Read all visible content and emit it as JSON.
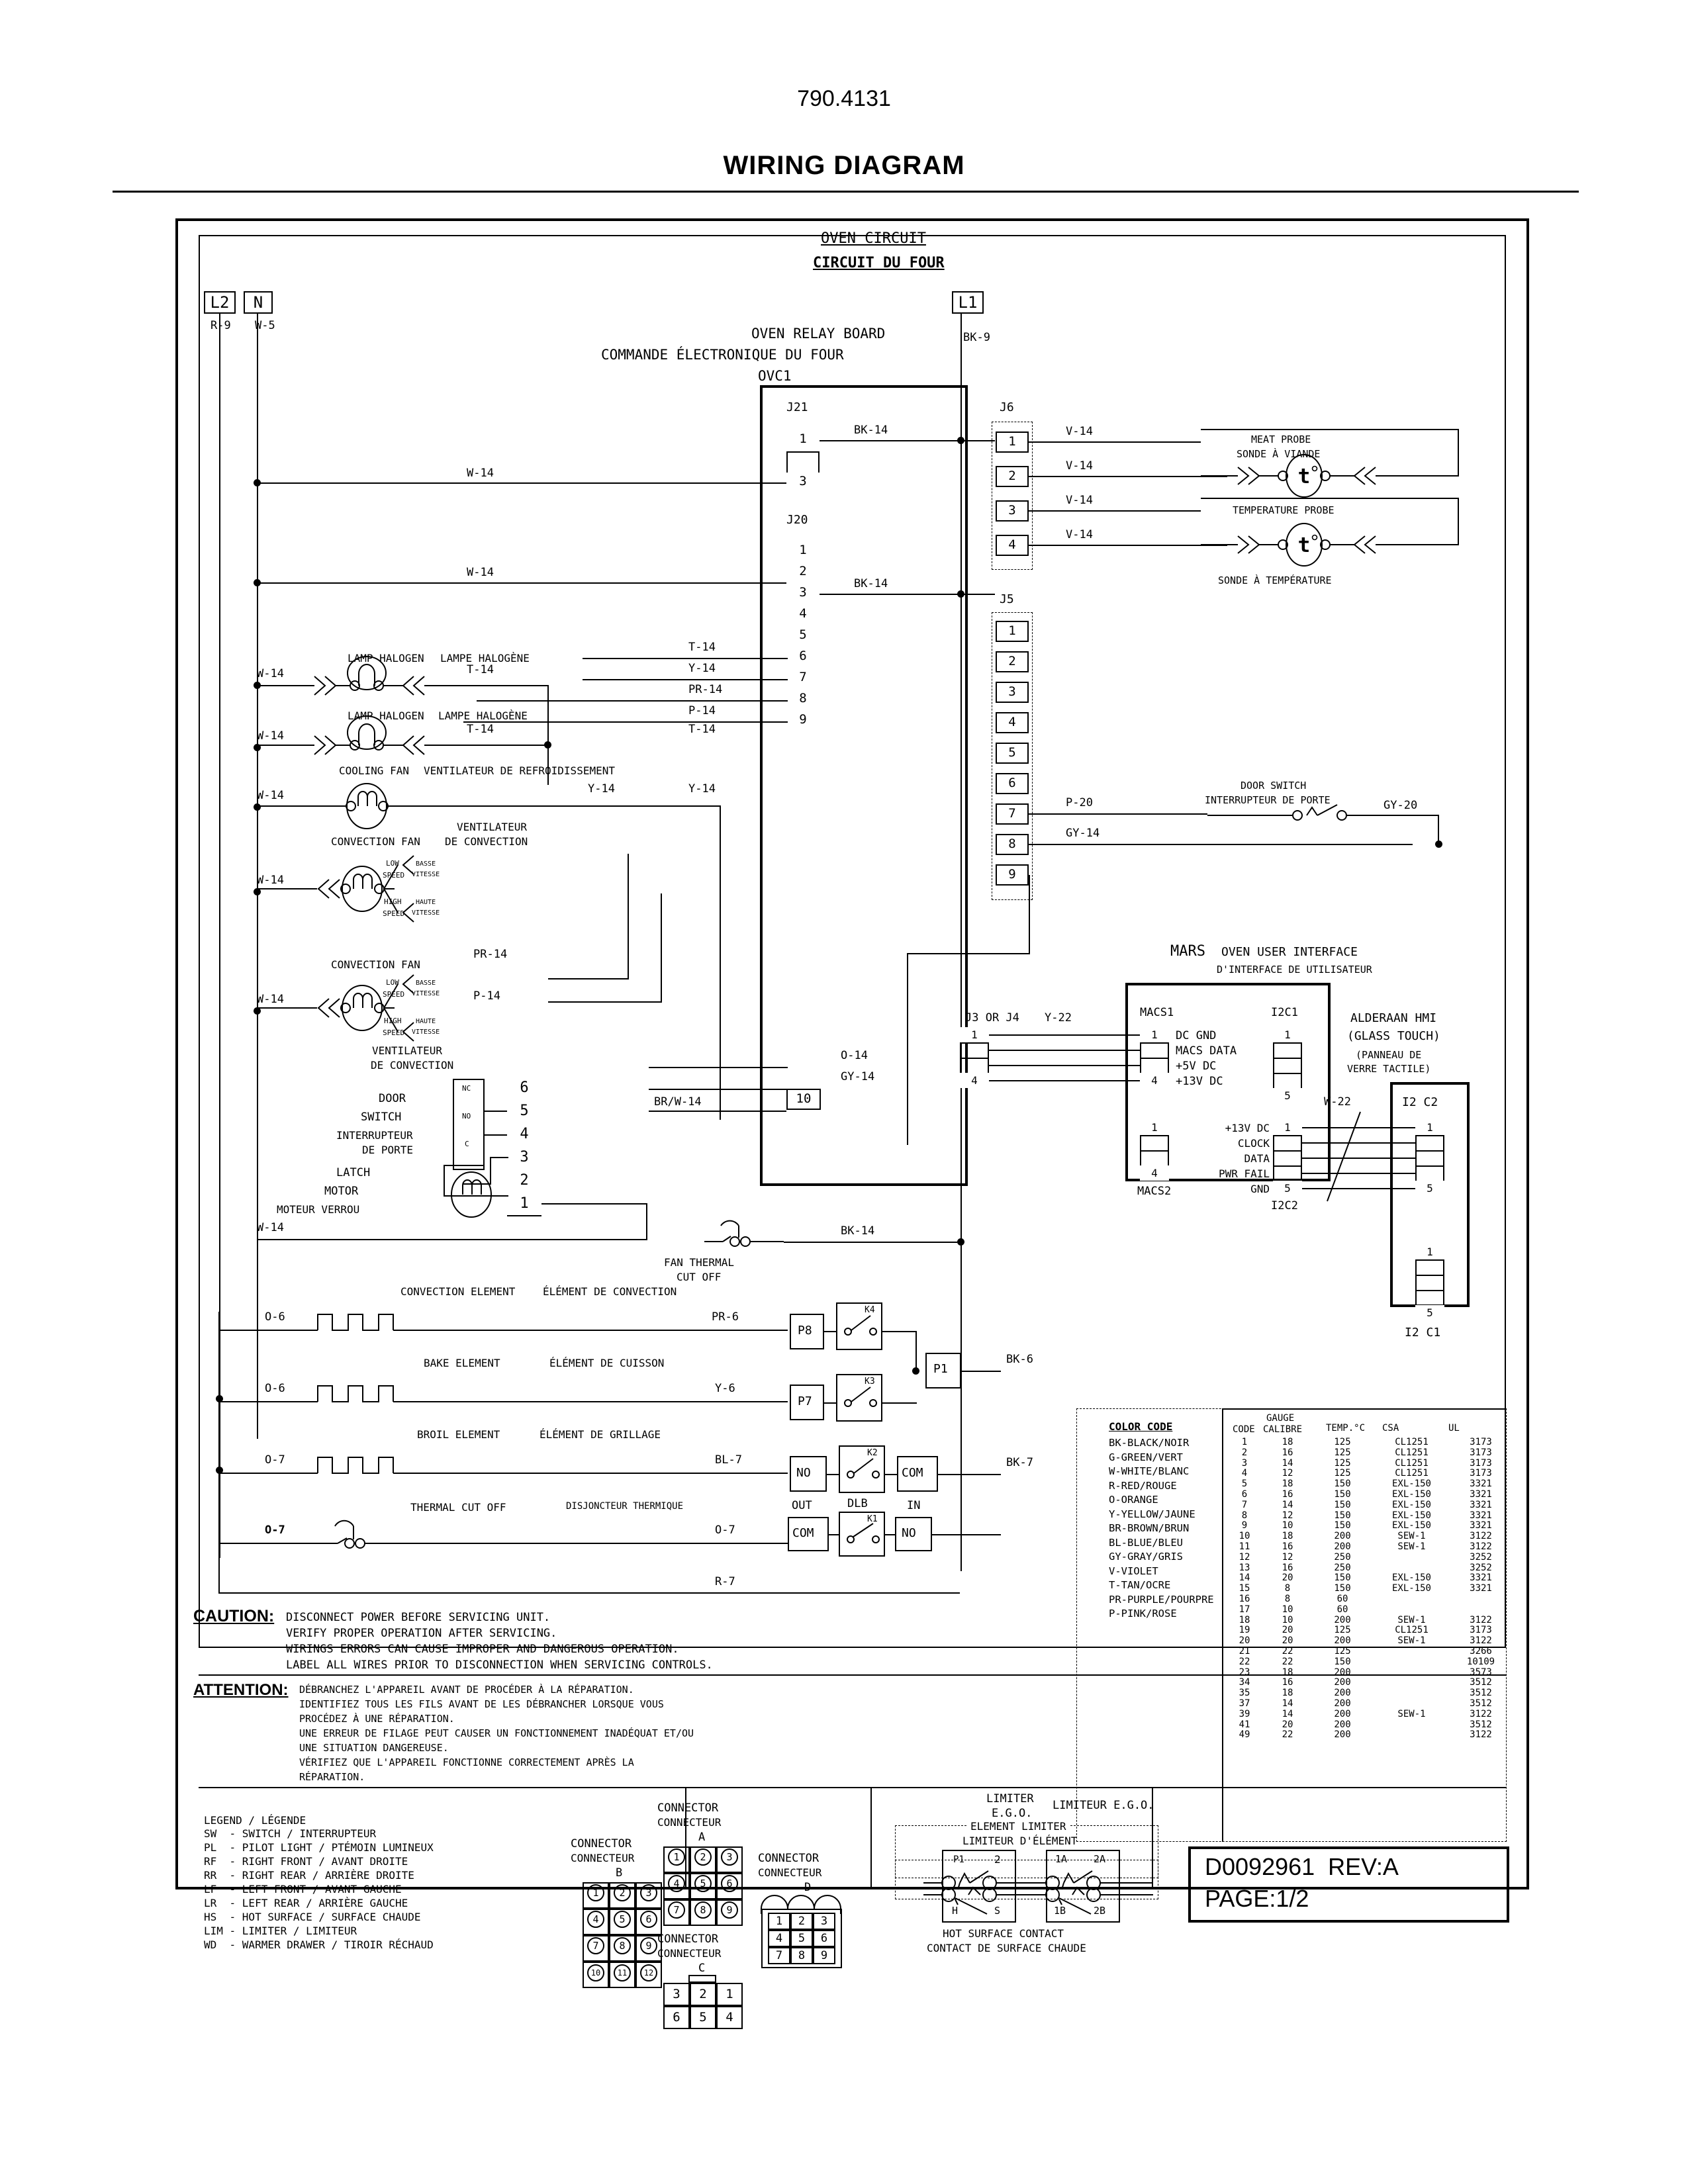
{
  "header": {
    "model": "790.4131",
    "title": "WIRING DIAGRAM"
  },
  "diagram": {
    "circuit_title_en": "OVEN CIRCUIT",
    "circuit_title_fr": "CIRCUIT DU FOUR",
    "terminals": {
      "l2": "L2",
      "n": "N",
      "l1": "L1"
    },
    "terminal_wires": {
      "l2": "R-9",
      "n": "W-5",
      "l1": "BK-9"
    },
    "relay_board": {
      "name_en": "OVEN RELAY BOARD",
      "name_fr": "COMMANDE ÉLECTRONIQUE DU FOUR",
      "ref": "OVC1",
      "connectors": {
        "j21": {
          "label": "J21",
          "pins": [
            "1",
            "",
            "3"
          ]
        },
        "j20": {
          "label": "J20",
          "pins": [
            "1",
            "2",
            "3",
            "4",
            "5",
            "6",
            "7",
            "8",
            "9"
          ],
          "extra_pin": "10"
        },
        "j6": {
          "label": "J6",
          "pins": [
            "1",
            "2",
            "3",
            "4"
          ]
        },
        "j5": {
          "label": "J5",
          "pins": [
            "1",
            "2",
            "3",
            "4",
            "5",
            "6",
            "7",
            "8",
            "9"
          ]
        }
      },
      "wire_labels": {
        "j21_1": "BK-14",
        "j20_3": "BK-14",
        "j20_6": "T-14",
        "j20_7": "Y-14",
        "j20_8": "PR-14",
        "j20_9": "P-14",
        "j20_10_a": "O-14",
        "j20_10_b": "GY-14",
        "j20_10_c": "BR/W-14",
        "j6_1": "V-14",
        "j6_2": "V-14",
        "j6_3": "V-14",
        "j6_4": "V-14",
        "j5_7": "P-20",
        "j5_8": "GY-14",
        "bk14_bottom": "BK-14"
      }
    },
    "probes": [
      {
        "name_en": "MEAT PROBE",
        "name_fr": "SONDE À VIANDE",
        "symbol": "t"
      },
      {
        "name_en": "TEMPERATURE PROBE",
        "name_fr": "SONDE À TEMPÉRATURE",
        "symbol": "t"
      }
    ],
    "door_switch_right": {
      "name_en": "DOOR SWITCH",
      "name_fr": "INTERRUPTEUR DE PORTE",
      "wire_out": "GY-20"
    },
    "left_branch": [
      {
        "name_en": "LAMP HALOGEN",
        "name_fr": "LAMPE HALOGÈNE",
        "in": "W-14",
        "out": "T-14"
      },
      {
        "name_en": "LAMP HALOGEN",
        "name_fr": "LAMPE HALOGÈNE",
        "in": "W-14",
        "out": "T-14",
        "out2": "T-14"
      },
      {
        "name_en": "COOLING FAN",
        "name_fr": "VENTILATEUR DE REFROIDISSEMENT",
        "in": "W-14",
        "out": "Y-14",
        "out2": "Y-14"
      },
      {
        "name_en": "CONVECTION FAN",
        "name_fr": "VENTILATEUR DE CONVECTION",
        "in": "W-14",
        "out": "PR-14",
        "out2": "P-14",
        "speed_low_en": "LOW SPEED",
        "speed_low_fr": "BASSE VITESSE",
        "speed_high_en": "HIGH SPEED",
        "speed_high_fr": "HAUTE VITESSE"
      },
      {
        "name_en": "CONVECTION FAN",
        "name_fr": "VENTILATEUR DE CONVECTION",
        "in": "W-14",
        "out": "PR-14",
        "out2": "P-14",
        "speed_low_en": "LOW SPEED",
        "speed_low_fr": "BASSE VITESSE",
        "speed_high_en": "HIGH SPEED",
        "speed_high_fr": "HAUTE VITESSE"
      }
    ],
    "door_latch": {
      "door_switch_en": "DOOR SWITCH",
      "door_switch_fr": "INTERRUPTEUR DE PORTE",
      "latch_motor_en": "LATCH MOTOR",
      "latch_motor_fr": "MOTEUR VERROU",
      "sw_pins": [
        "NC",
        "NO",
        "C"
      ],
      "conn_pins": [
        "6",
        "5",
        "4",
        "3",
        "2",
        "1"
      ],
      "wire_in": "W-14"
    },
    "fan_thermal": {
      "label_en": "FAN THERMAL",
      "label_fr": "CUT OFF"
    },
    "elements": [
      {
        "name_en": "CONVECTION ELEMENT",
        "name_fr": "ÉLÉMENT DE CONVECTION",
        "left": "O-6",
        "right": "PR-6",
        "term": "P8",
        "relay": "K4"
      },
      {
        "name_en": "BAKE ELEMENT",
        "name_fr": "ÉLÉMENT DE CUISSON",
        "left": "O-6",
        "right": "Y-6",
        "term": "P7",
        "relay": "K3"
      },
      {
        "name_en": "BROIL ELEMENT",
        "name_fr": "ÉLÉMENT DE GRILLAGE",
        "left": "O-7",
        "right": "BL-7",
        "term": "NO",
        "relay": "K2",
        "term2": "COM"
      },
      {
        "name_en": "THERMAL CUT OFF",
        "name_fr": "DISJONCTEUR THERMIQUE",
        "left": "O-7",
        "right": "O-7",
        "term": "COM",
        "relay": "K1",
        "term2": "NO"
      }
    ],
    "relay_out": {
      "p1": "P1",
      "bk6": "BK-6",
      "bk7": "BK-7",
      "out_lbl": "OUT",
      "dlb_lbl": "DLB",
      "in_lbl": "IN",
      "r7": "R-7"
    },
    "mars": {
      "brand": "MARS",
      "title_en": "OVEN USER INTERFACE",
      "title_fr": "D'INTERFACE DE UTILISATEUR",
      "j3_or_j4": "J3 OR J4",
      "y22": "Y-22",
      "macs1_label": "MACS1",
      "macs2_label": "MACS2",
      "i2c1_label": "I2C1",
      "i2c2_label": "I2C2",
      "macs1_signals": [
        "DC GND",
        "MACS DATA",
        "+5V DC",
        "+13V DC"
      ],
      "i2c2_signals": [
        "+13V DC",
        "CLOCK",
        "DATA",
        "PWR FAIL",
        "GND"
      ],
      "macs1_pins": [
        "1",
        "4"
      ],
      "macs2_pins": [
        "1",
        "4"
      ],
      "i2c1_pins": [
        "1",
        "5"
      ],
      "i2c2_pins": [
        "1",
        "5"
      ],
      "hmi_name": "ALDERAAN HMI",
      "hmi_sub_en": "(GLASS TOUCH)",
      "hmi_sub_fr": "(PANNEAU DE VERRE TACTILE)",
      "hmi_conn_top": "I2 C2",
      "hmi_conn_bottom": "I2 C1",
      "w22": "W-22",
      "hmi_pins": [
        "1",
        "5"
      ]
    },
    "caution": {
      "label": "CAUTION:",
      "lines": [
        "DISCONNECT POWER BEFORE SERVICING UNIT.",
        "VERIFY PROPER OPERATION AFTER SERVICING.",
        "WIRINGS ERRORS CAN CAUSE IMPROPER AND DANGEROUS OPERATION.",
        "LABEL ALL WIRES PRIOR TO DISCONNECTION WHEN SERVICING CONTROLS."
      ]
    },
    "attention": {
      "label": "ATTENTION:",
      "lines": [
        "DÉBRANCHEZ L'APPAREIL AVANT DE PROCÉDER À LA RÉPARATION.",
        "IDENTIFIEZ TOUS LES FILS AVANT DE LES DÉBRANCHER LORSQUE VOUS",
        "PROCÉDEZ À UNE RÉPARATION.",
        "UNE ERREUR DE FILAGE PEUT CAUSER UN FONCTIONNEMENT INADÉQUAT ET/OU",
        "UNE SITUATION DANGEREUSE.",
        "VÉRIFIEZ QUE L'APPAREIL FONCTIONNE CORRECTEMENT APRÈS LA",
        "RÉPARATION."
      ]
    },
    "legend": {
      "title": "LEGEND / LÉGENDE",
      "items": [
        "SW  - SWITCH / INTERRUPTEUR",
        "PL  - PILOT LIGHT / PTÉMOIN LUMINEUX",
        "RF  - RIGHT FRONT / AVANT DROITE",
        "RR  - RIGHT REAR / ARRIÈRE DROITE",
        "LF  - LEFT FRONT / AVANT GAUCHE",
        "LR  - LEFT REAR / ARRIÈRE GAUCHE",
        "HS  - HOT SURFACE / SURFACE CHAUDE",
        "LIM - LIMITER / LIMITEUR",
        "WD  - WARMER DRAWER / TIROIR RÉCHAUD"
      ]
    },
    "connectors": [
      {
        "id": "A",
        "title_en": "CONNECTOR",
        "title_fr": "CONNECTEUR",
        "cells": [
          "1",
          "2",
          "3",
          "4",
          "5",
          "6",
          "7",
          "8",
          "9"
        ],
        "cols": 3,
        "style": "circle"
      },
      {
        "id": "B",
        "title_en": "CONNECTOR",
        "title_fr": "CONNECTEUR",
        "cells": [
          "1",
          "2",
          "3",
          "4",
          "5",
          "6",
          "7",
          "8",
          "9",
          "10",
          "11",
          "12"
        ],
        "cols": 3,
        "style": "circle"
      },
      {
        "id": "C",
        "title_en": "CONNECTOR",
        "title_fr": "CONNECTEUR",
        "cells": [
          "3",
          "2",
          "1",
          "6",
          "5",
          "4"
        ],
        "cols": 3,
        "style": "plain"
      },
      {
        "id": "D",
        "title_en": "CONNECTOR",
        "title_fr": "CONNECTEUR",
        "cells": [
          "1",
          "2",
          "3",
          "4",
          "5",
          "6",
          "7",
          "8",
          "9"
        ],
        "cols": 3,
        "style": "plain"
      }
    ],
    "limiter": {
      "title_en": "LIMITER\nE.G.O.",
      "title_fr": "LIMITEUR E.G.O.",
      "element_limiter_en": "ELEMENT LIMITER",
      "element_limiter_fr": "LIMITEUR D'ÉLÉMENT",
      "hot_surface_en": "HOT SURFACE CONTACT",
      "hot_surface_fr": "CONTACT DE SURFACE CHAUDE",
      "block1": {
        "tl": "P1",
        "tr": "2",
        "bl": "H",
        "br": "S"
      },
      "block2": {
        "tl": "1A",
        "tr": "2A",
        "bl": "1B",
        "br": "2B"
      }
    },
    "color_code": {
      "title": "COLOR CODE",
      "items": [
        "BK-BLACK/NOIR",
        "G-GREEN/VERT",
        "W-WHITE/BLANC",
        "R-RED/ROUGE",
        "O-ORANGE",
        "Y-YELLOW/JAUNE",
        "BR-BROWN/BRUN",
        "BL-BLUE/BLEU",
        "GY-GRAY/GRIS",
        "V-VIOLET",
        "T-TAN/OCRE",
        "PR-PURPLE/POURPRE",
        "P-PINK/ROSE"
      ]
    },
    "gauge_table": {
      "headers": [
        "CODE",
        "GAUGE\nCALIBRE",
        "TEMP.°C",
        "CSA",
        "UL"
      ],
      "header_code": "CODE",
      "header_gauge_top": "GAUGE",
      "header_gauge_bottom": "CALIBRE",
      "header_temp": "TEMP.°C",
      "header_csa": "CSA",
      "header_ul": "UL",
      "rows": [
        [
          "1",
          "18",
          "125",
          "CL1251",
          "3173"
        ],
        [
          "2",
          "16",
          "125",
          "CL1251",
          "3173"
        ],
        [
          "3",
          "14",
          "125",
          "CL1251",
          "3173"
        ],
        [
          "4",
          "12",
          "125",
          "CL1251",
          "3173"
        ],
        [
          "5",
          "18",
          "150",
          "EXL-150",
          "3321"
        ],
        [
          "6",
          "16",
          "150",
          "EXL-150",
          "3321"
        ],
        [
          "7",
          "14",
          "150",
          "EXL-150",
          "3321"
        ],
        [
          "8",
          "12",
          "150",
          "EXL-150",
          "3321"
        ],
        [
          "9",
          "10",
          "150",
          "EXL-150",
          "3321"
        ],
        [
          "10",
          "18",
          "200",
          "SEW-1",
          "3122"
        ],
        [
          "11",
          "16",
          "200",
          "SEW-1",
          "3122"
        ],
        [
          "12",
          "12",
          "250",
          "",
          "3252"
        ],
        [
          "13",
          "16",
          "250",
          "",
          "3252"
        ],
        [
          "14",
          "20",
          "150",
          "EXL-150",
          "3321"
        ],
        [
          "15",
          "8",
          "150",
          "EXL-150",
          "3321"
        ],
        [
          "16",
          "8",
          "60",
          "",
          ""
        ],
        [
          "17",
          "10",
          "60",
          "",
          ""
        ],
        [
          "18",
          "10",
          "200",
          "SEW-1",
          "3122"
        ],
        [
          "19",
          "20",
          "125",
          "CL1251",
          "3173"
        ],
        [
          "20",
          "20",
          "200",
          "SEW-1",
          "3122"
        ],
        [
          "21",
          "22",
          "125",
          "",
          "3266"
        ],
        [
          "22",
          "22",
          "150",
          "",
          "10109"
        ],
        [
          "23",
          "18",
          "200",
          "",
          "3573"
        ],
        [
          "34",
          "16",
          "200",
          "",
          "3512"
        ],
        [
          "35",
          "18",
          "200",
          "",
          "3512"
        ],
        [
          "37",
          "14",
          "200",
          "",
          "3512"
        ],
        [
          "39",
          "14",
          "200",
          "SEW-1",
          "3122"
        ],
        [
          "41",
          "20",
          "200",
          "",
          "3512"
        ],
        [
          "49",
          "22",
          "200",
          "",
          "3122"
        ]
      ]
    },
    "docblock": {
      "number": "D0092961  REV:A",
      "page": "PAGE:1/2"
    }
  }
}
